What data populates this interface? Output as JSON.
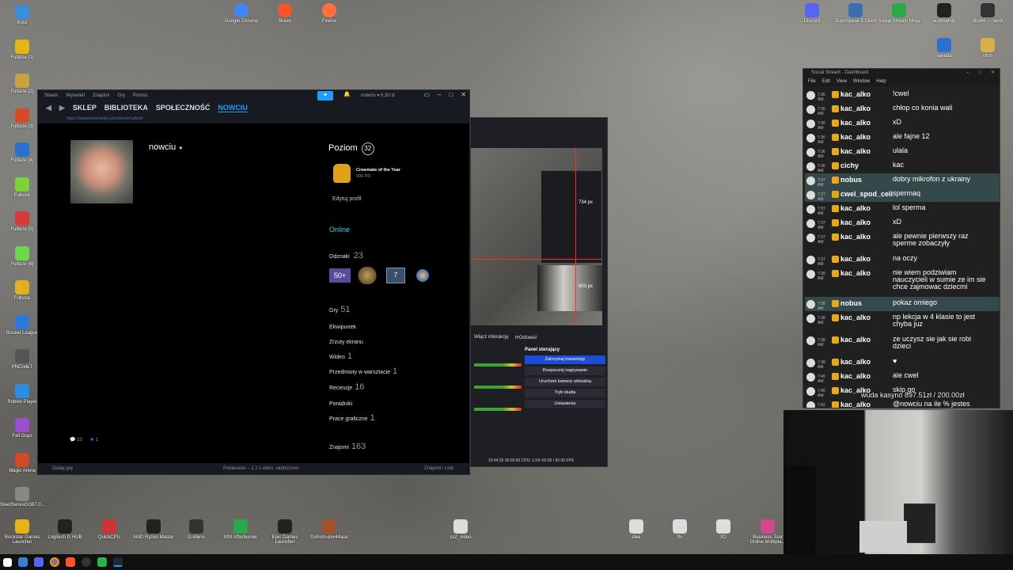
{
  "desktop": {
    "left_icons": [
      "Kosz",
      "Fullsize (1)",
      "Fullsize (2)",
      "Fullsize (3)",
      "Fullsize (4)",
      "Fullsize",
      "Fullsize (5)",
      "Fullsize (6)",
      "Fullsize",
      "Rocket League",
      "PNCodeT",
      "Roblox Player",
      "Fall Guys",
      "Magic Arena",
      "SteelSeriesGG87.0..."
    ],
    "top_icons": [
      "Google Chrome",
      "Brave",
      "Firefox"
    ],
    "right_top_icons": [
      "Discord",
      "TeamSpeak 3 Client",
      "Social Stream Ninja",
      "w.streamly",
      "obs64 — skrót",
      "vavada",
      "strim"
    ],
    "bottom_icons": [
      "Rockstar Games Launcher",
      "Logitech G HUB",
      "QuickCPU",
      "AMD Ryzen Master",
      "G-Menu",
      "MSI Afterburner",
      "Epic Games Launcher",
      "Gvhorn-evv44aux",
      "cs2_video",
      "dwa",
      "ttv",
      "XD",
      "Business Tour Online Multipla..."
    ]
  },
  "steam": {
    "title_menu": [
      "Steam",
      "Wyświetl",
      "Znajomi",
      "Gry",
      "Pomoc"
    ],
    "account": "nowciu ▾ 0,30 zł",
    "nav": [
      "SKLEP",
      "BIBLIOTEKA",
      "SPOŁECZNOŚĆ",
      "NOWCIU"
    ],
    "url": "https://steamcommunity.com/id/nowciu/kick/",
    "profile_name": "nowciu",
    "level_label": "Poziom",
    "level": "32",
    "badge_title": "Crewmate of the Year",
    "badge_xp": "500 PD",
    "edit_profile": "Edytuj profil",
    "online": "Online",
    "badges_label": "Odznaki",
    "badges_count": "23",
    "badge_tiles": [
      "50+",
      "",
      "7",
      ""
    ],
    "stats": [
      {
        "label": "Gry",
        "num": "51"
      },
      {
        "label": "Ekwipunek",
        "num": ""
      },
      {
        "label": "Zrzuty ekranu",
        "num": ""
      },
      {
        "label": "Wideo",
        "num": "1"
      },
      {
        "label": "Przedmioty w warsztacie",
        "num": "1"
      },
      {
        "label": "Recenzje",
        "num": "16"
      },
      {
        "label": "Poradniki",
        "num": ""
      },
      {
        "label": "Prace graficzne",
        "num": "1"
      },
      {
        "label": "Znajomi",
        "num": "163"
      }
    ],
    "footer_counts": [
      "10",
      "1"
    ],
    "statusbar_left": "Dodaj grę",
    "statusbar_mid": "Pobieranie – 1 z 1 elem. ukończono",
    "statusbar_right": "Znajomi i czat"
  },
  "obs": {
    "interact_btn": "Włącz interakcję",
    "refresh_btn": "Odśwież",
    "panel_title": "Panel sterujący",
    "controls": [
      "Zatrzymaj transmisję",
      "Rozpocznij nagrywanie",
      "Uruchom kamerę wirtualną",
      "Tryb studia",
      "Ustawienia"
    ],
    "status": "15:44:26   00:00:00   CPU: 1.5%   60.00 / 60.00 FPS",
    "px1": "734 px",
    "px2": "603 px"
  },
  "chat": {
    "title": "Social Stream - Dashboard",
    "menu": [
      "File",
      "Edit",
      "View",
      "Window",
      "Help"
    ],
    "messages": [
      {
        "t": "7:36 AM",
        "n": "kac_alko",
        "m": "!cwel"
      },
      {
        "t": "7:36 AM",
        "n": "kac_alko",
        "m": "chłop co konia wali"
      },
      {
        "t": "7:36 AM",
        "n": "kac_alko",
        "m": "xD"
      },
      {
        "t": "7:36 AM",
        "n": "kac_alko",
        "m": "ale fajne 12"
      },
      {
        "t": "7:36 AM",
        "n": "kac_alko",
        "m": "ulala"
      },
      {
        "t": "7:36 AM",
        "n": "cichy",
        "m": "kac"
      },
      {
        "t": "7:37 AM",
        "n": "nobus",
        "m": "dobry mikrofon z ukrainy",
        "hl": true
      },
      {
        "t": "7:37 AM",
        "n": "cwel_spod_celi",
        "m": "spermaq",
        "hl": true
      },
      {
        "t": "7:37 AM",
        "n": "kac_alko",
        "m": "lol sperma"
      },
      {
        "t": "7:37 AM",
        "n": "kac_alko",
        "m": "xD"
      },
      {
        "t": "7:37 AM",
        "n": "kac_alko",
        "m": "ale pewnie pierwszy raz sperme zobaczyły"
      },
      {
        "t": "7:37 AM",
        "n": "kac_alko",
        "m": "na oczy"
      },
      {
        "t": "7:38 AM",
        "n": "kac_alko",
        "m": "nie wiem podziwiam nauczycieli w sumie ze im sie chce zajmowac dziecmi"
      },
      {
        "t": "7:38 AM",
        "n": "nobus",
        "m": "pokaz omiego",
        "hl": true
      },
      {
        "t": "7:38 AM",
        "n": "kac_alko",
        "m": "np lekcja w 4 klasie to jest chyba juz"
      },
      {
        "t": "7:38 AM",
        "n": "kac_alko",
        "m": "ze uczysz sie jak sie robi dzieci"
      },
      {
        "t": "7:38 AM",
        "n": "kac_alko",
        "m": "♥"
      },
      {
        "t": "7:40 AM",
        "n": "kac_alko",
        "m": "ale cwel"
      },
      {
        "t": "7:40 AM",
        "n": "kac_alko",
        "m": "skip go"
      },
      {
        "t": "7:42 AM",
        "n": "kac_alko",
        "m": "@nowciu na ile % jestes dzisiaj cwelem"
      }
    ],
    "overlay": "wuda kasyno 897.51zł / 200.00zł"
  },
  "colors": {
    "steam_blue": "#1a9fff",
    "steam_bg": "#000000",
    "obs_stop": "#1b4dd8",
    "chat_highlight": "#35484a"
  }
}
